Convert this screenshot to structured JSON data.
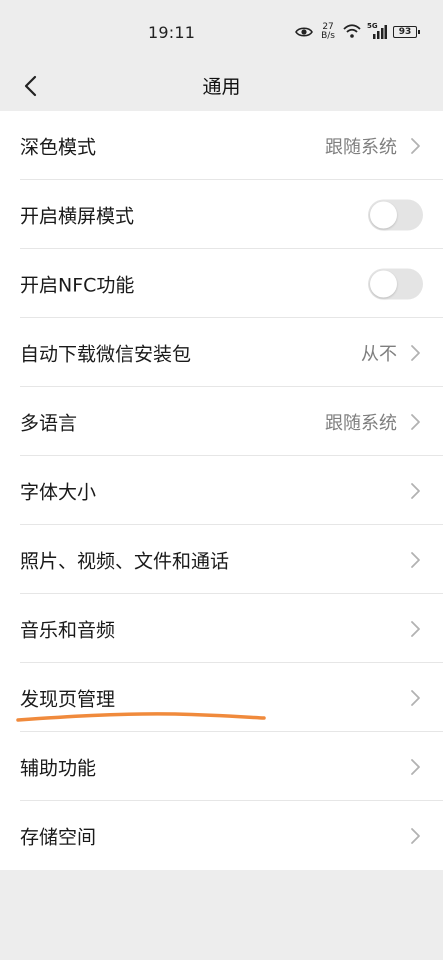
{
  "status_bar": {
    "time": "19:11",
    "net_speed_value": "27",
    "net_speed_unit": "B/s",
    "network_type": "5G",
    "battery_level": "93"
  },
  "nav": {
    "title": "通用"
  },
  "settings": [
    {
      "label": "深色模式",
      "value": "跟随系统",
      "control": "chevron"
    },
    {
      "label": "开启横屏模式",
      "value": "",
      "control": "toggle",
      "on": false
    },
    {
      "label": "开启NFC功能",
      "value": "",
      "control": "toggle",
      "on": false
    },
    {
      "label": "自动下载微信安装包",
      "value": "从不",
      "control": "chevron"
    },
    {
      "label": "多语言",
      "value": "跟随系统",
      "control": "chevron"
    },
    {
      "label": "字体大小",
      "value": "",
      "control": "chevron"
    },
    {
      "label": "照片、视频、文件和通话",
      "value": "",
      "control": "chevron"
    },
    {
      "label": "音乐和音频",
      "value": "",
      "control": "chevron"
    },
    {
      "label": "发现页管理",
      "value": "",
      "control": "chevron"
    },
    {
      "label": "辅助功能",
      "value": "",
      "control": "chevron"
    },
    {
      "label": "存储空间",
      "value": "",
      "control": "chevron"
    }
  ],
  "colors": {
    "background": "#ededed",
    "card": "#ffffff",
    "annotation_underline": "#f08a3c"
  }
}
